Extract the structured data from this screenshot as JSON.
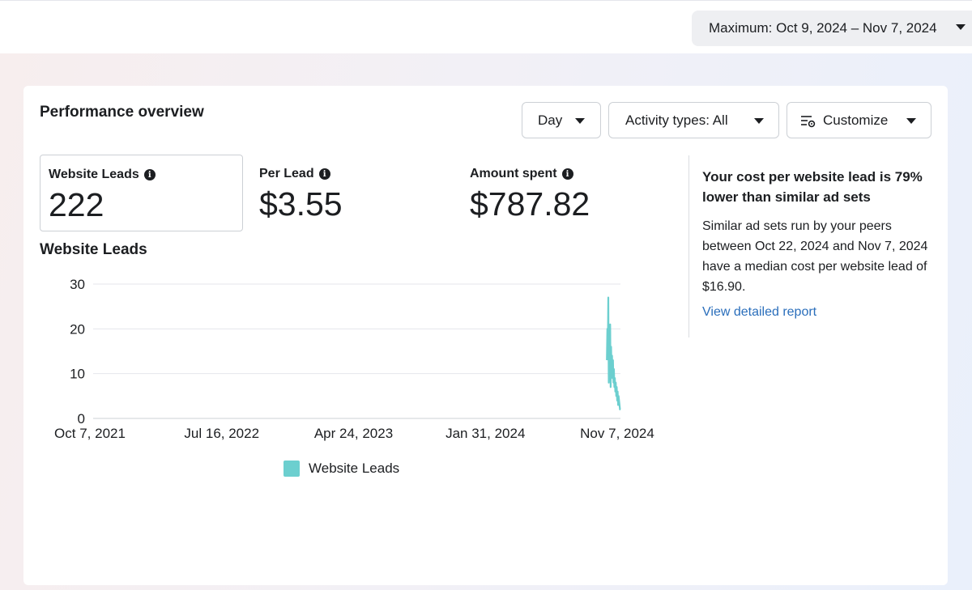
{
  "date_range": {
    "label": "Maximum: Oct 9, 2024 – Nov 7, 2024"
  },
  "card": {
    "title": "Performance overview",
    "controls": {
      "day_label": "Day",
      "activity_label": "Activity types: All",
      "customize_label": "Customize"
    },
    "metrics": [
      {
        "label": "Website Leads",
        "value": "222"
      },
      {
        "label": "Per Lead",
        "value": "$3.55"
      },
      {
        "label": "Amount spent",
        "value": "$787.82"
      }
    ],
    "chart_title": "Website Leads",
    "insight": {
      "headline": "Your cost per website lead is 79% lower than similar ad sets",
      "body": "Similar ad sets run by your peers between Oct 22, 2024 and Nov 7, 2024 have a median cost per website lead of $16.90.",
      "link": "View detailed report"
    }
  },
  "chart_data": {
    "type": "line",
    "title": "Website Leads",
    "x_tick_labels": [
      "Oct 7, 2021",
      "Jul 16, 2022",
      "Apr 24, 2023",
      "Jan 31, 2024",
      "Nov 7, 2024"
    ],
    "x_range": [
      "2021-10-07",
      "2024-11-07"
    ],
    "y_ticks": [
      0,
      10,
      20,
      30
    ],
    "ylim": [
      0,
      30
    ],
    "grid": true,
    "legend": "bottom",
    "series": [
      {
        "name": "Website Leads",
        "color": "#6ccfcf",
        "points": [
          [
            "2024-10-09",
            13
          ],
          [
            "2024-10-10",
            20
          ],
          [
            "2024-10-11",
            15
          ],
          [
            "2024-10-12",
            27
          ],
          [
            "2024-10-13",
            8
          ],
          [
            "2024-10-14",
            18
          ],
          [
            "2024-10-15",
            12
          ],
          [
            "2024-10-16",
            21
          ],
          [
            "2024-10-17",
            7
          ],
          [
            "2024-10-18",
            16
          ],
          [
            "2024-10-19",
            10
          ],
          [
            "2024-10-20",
            14
          ],
          [
            "2024-10-21",
            9
          ],
          [
            "2024-10-22",
            13
          ],
          [
            "2024-10-23",
            8
          ],
          [
            "2024-10-24",
            11
          ],
          [
            "2024-10-25",
            7
          ],
          [
            "2024-10-26",
            9
          ],
          [
            "2024-10-27",
            6
          ],
          [
            "2024-10-28",
            8
          ],
          [
            "2024-10-29",
            5
          ],
          [
            "2024-10-30",
            7
          ],
          [
            "2024-10-31",
            4
          ],
          [
            "2024-11-01",
            6
          ],
          [
            "2024-11-02",
            3
          ],
          [
            "2024-11-03",
            5
          ],
          [
            "2024-11-04",
            4
          ],
          [
            "2024-11-05",
            3
          ],
          [
            "2024-11-06",
            2
          ],
          [
            "2024-11-07",
            2
          ]
        ]
      }
    ]
  }
}
